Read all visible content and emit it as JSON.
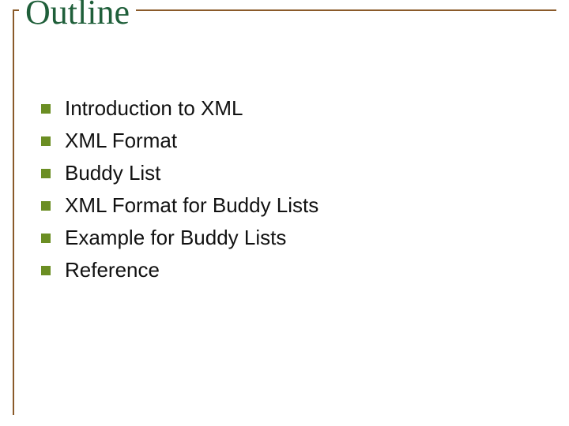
{
  "title": "Outline",
  "bullets": [
    "Introduction to XML",
    "XML Format",
    "Buddy List",
    "XML Format for Buddy Lists",
    "Example for Buddy Lists",
    "Reference"
  ],
  "colors": {
    "title": "#1f5f3a",
    "rule": "#8a5a2a",
    "bullet": "#6b8e23",
    "text": "#111111"
  }
}
